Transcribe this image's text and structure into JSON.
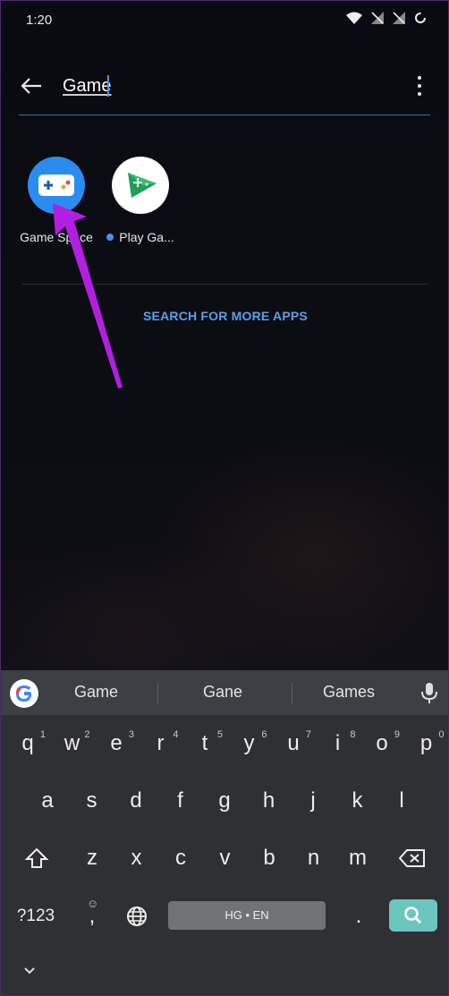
{
  "status_bar": {
    "time": "1:20"
  },
  "search": {
    "query": "Game"
  },
  "results": {
    "apps": [
      {
        "label": "Game Space",
        "label_visible": "Game Space"
      },
      {
        "label": "Play Ga...",
        "has_new_dot": true
      }
    ],
    "more_apps": "SEARCH FOR MORE APPS"
  },
  "keyboard": {
    "suggestions": [
      "Game",
      "Gane",
      "Games"
    ],
    "row1": [
      {
        "k": "q",
        "h": "1"
      },
      {
        "k": "w",
        "h": "2"
      },
      {
        "k": "e",
        "h": "3"
      },
      {
        "k": "r",
        "h": "4"
      },
      {
        "k": "t",
        "h": "5"
      },
      {
        "k": "y",
        "h": "6"
      },
      {
        "k": "u",
        "h": "7"
      },
      {
        "k": "i",
        "h": "8"
      },
      {
        "k": "o",
        "h": "9"
      },
      {
        "k": "p",
        "h": "0"
      }
    ],
    "row2": [
      "a",
      "s",
      "d",
      "f",
      "g",
      "h",
      "j",
      "k",
      "l"
    ],
    "row3": [
      "z",
      "x",
      "c",
      "v",
      "b",
      "n",
      "m"
    ],
    "symbols_key": "?123",
    "comma_key": ",",
    "emoji_hint": "☺",
    "space_label": "HG • EN",
    "period_key": "."
  },
  "colors": {
    "accent_blue": "#5aa0e8",
    "annotation_arrow": "#b31fe0",
    "search_key": "#6cc6c0"
  },
  "icons": [
    "back-arrow-icon",
    "overflow-menu-icon",
    "game-space-icon",
    "play-games-icon",
    "google-icon",
    "mic-icon",
    "shift-icon",
    "backspace-icon",
    "globe-icon",
    "search-icon",
    "chevron-down-icon",
    "wifi-icon",
    "signal-off-icon",
    "loading-icon"
  ]
}
